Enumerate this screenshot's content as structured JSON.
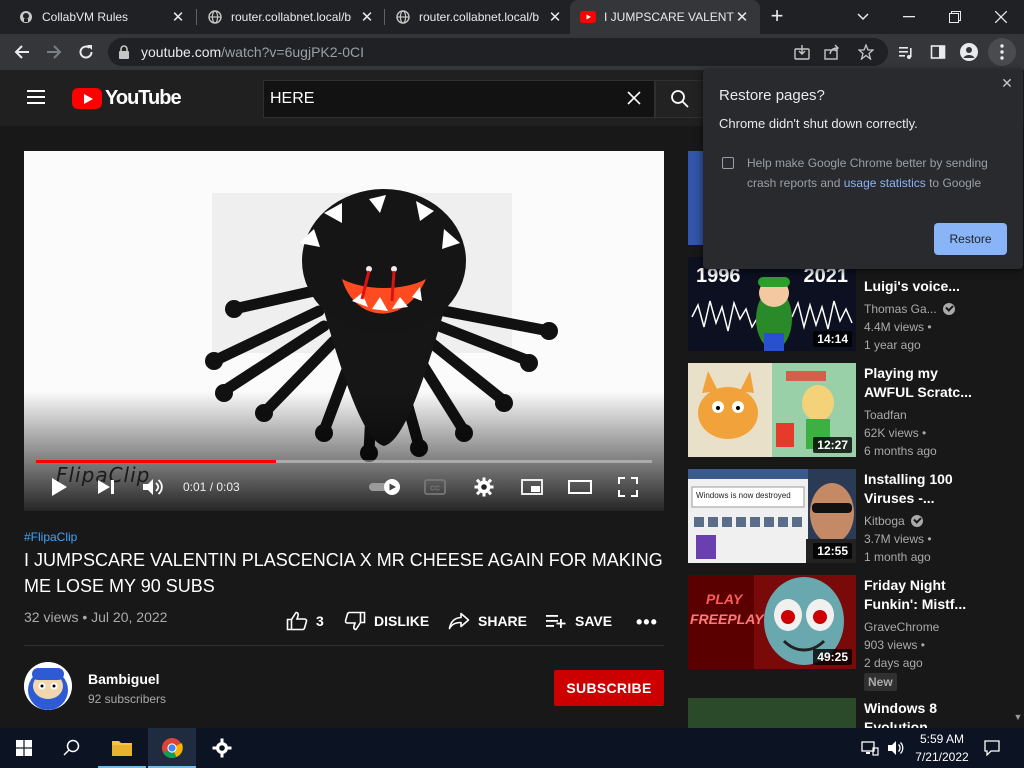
{
  "browser": {
    "tabs": [
      {
        "title": "CollabVM Rules",
        "icon": "collabvm-icon"
      },
      {
        "title": "router.collabnet.local/b",
        "icon": "globe-icon"
      },
      {
        "title": "router.collabnet.local/b",
        "icon": "globe-icon"
      },
      {
        "title": "I JUMPSCARE VALENTI",
        "icon": "youtube-icon"
      }
    ],
    "url_host": "youtube.com",
    "url_path": "/watch?v=6ugjPK2-0CI",
    "accent": "#8ab4f8"
  },
  "youtube": {
    "logo_text": "YouTube",
    "search_value": "HERE",
    "player": {
      "time": "0:01 / 0:03",
      "progress_fraction": 0.39,
      "watermark": "FlipaClip"
    },
    "video": {
      "hashtag": "#FlipaClip",
      "title": "I JUMPSCARE VALENTIN PLASCENCIA X MR CHEESE AGAIN FOR MAKING ME LOSE MY 90 SUBS",
      "views_date": "32 views • Jul 20, 2022",
      "likes": "3",
      "dislike_label": "DISLIKE",
      "share_label": "SHARE",
      "save_label": "SAVE",
      "more_label": "•••"
    },
    "channel": {
      "name": "Bambiguel",
      "subscribers": "92 subscribers",
      "subscribe_label": "SUBSCRIBE"
    },
    "recommendations": [
      {
        "title_line1": "Luigi's voice...",
        "channel": "Thomas Ga...",
        "verified": true,
        "views": "4.4M views •",
        "age": "1 year ago",
        "duration": "14:14",
        "thumb_left": "1996",
        "thumb_right": "2021"
      },
      {
        "title_line1": "Playing my",
        "title_line2": "AWFUL Scratc...",
        "channel": "Toadfan",
        "verified": false,
        "views": "62K views •",
        "age": "6 months ago",
        "duration": "12:27"
      },
      {
        "title_line1": "Installing 100",
        "title_line2": "Viruses -...",
        "channel": "Kitboga",
        "verified": true,
        "views": "3.7M views •",
        "age": "1 month ago",
        "duration": "12:55",
        "thumb_text": "Windows is now destroyed"
      },
      {
        "title_line1": "Friday Night",
        "title_line2": "Funkin': Mistf...",
        "channel": "GraveChrome",
        "verified": false,
        "views": "903 views •",
        "age": "2 days ago",
        "duration": "49:25",
        "badge": "New",
        "thumb_text1": "PLAY",
        "thumb_text2": "FREEPLAY"
      },
      {
        "title_line1": "Windows 8",
        "title_line2": "Evolution"
      }
    ]
  },
  "restore_popup": {
    "title": "Restore pages?",
    "subtitle": "Chrome didn't shut down correctly.",
    "checkbox_text_1": "Help make Google Chrome better by sending crash reports and ",
    "checkbox_link": "usage statistics",
    "checkbox_text_2": " to Google",
    "button": "Restore"
  },
  "taskbar": {
    "time": "5:59 AM",
    "date": "7/21/2022"
  }
}
